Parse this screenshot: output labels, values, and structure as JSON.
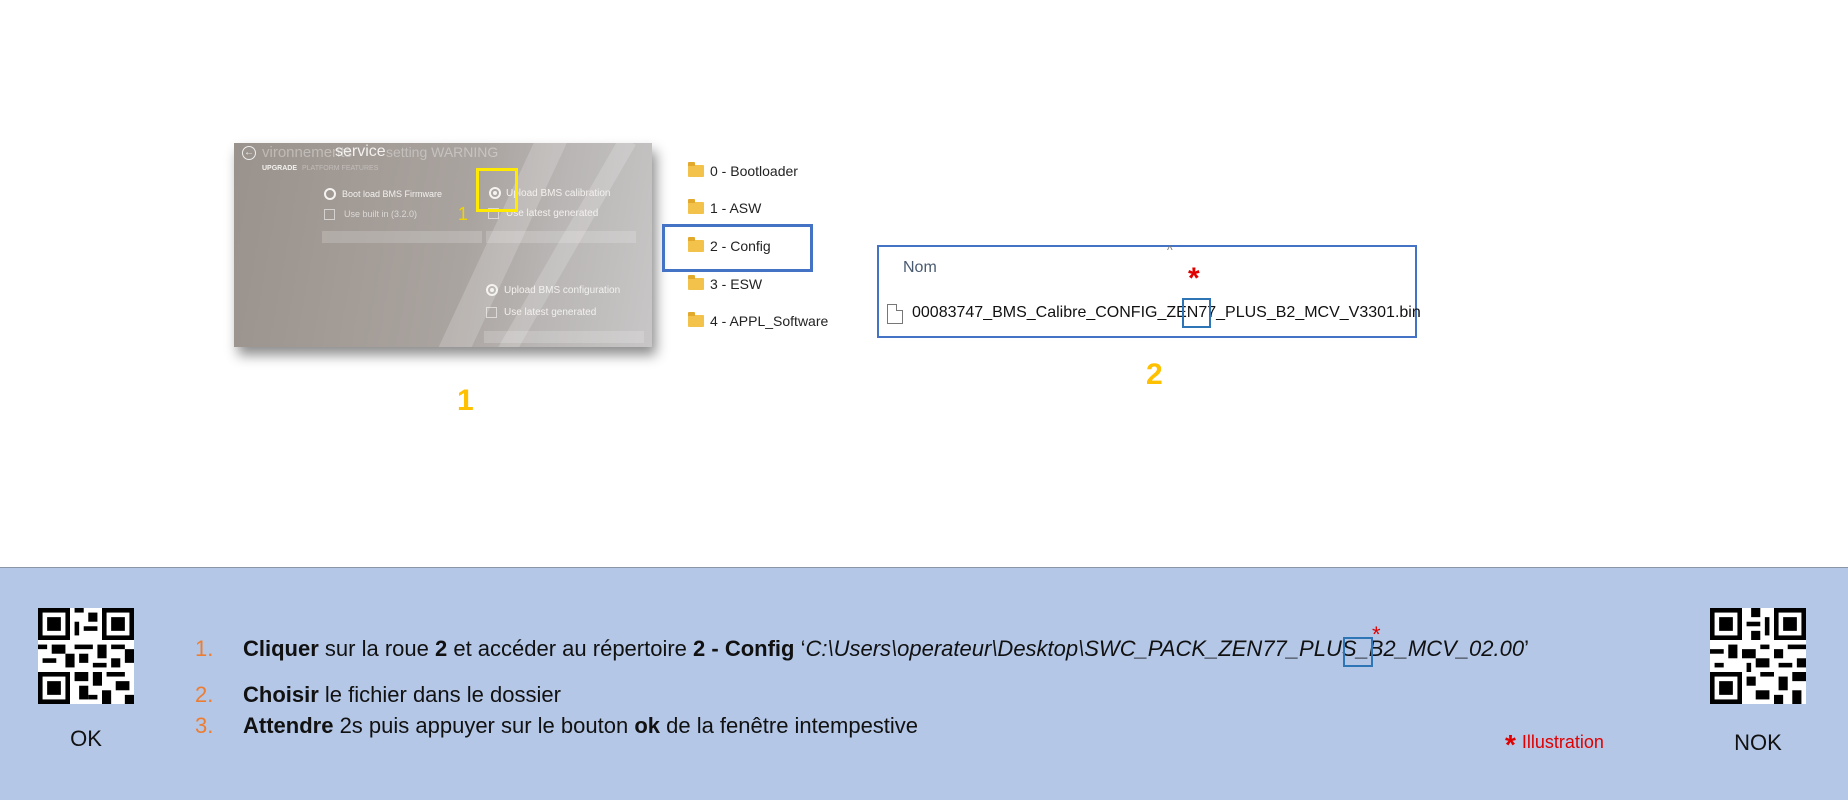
{
  "photo": {
    "header_dim_left": "vironnements",
    "header_title": "service",
    "header_dim_right": "setting  WARNING",
    "tab_upgrade": "UPGRADE",
    "tab_platform": "PLATFORM FEATURES",
    "option_bootload": "Boot load BMS Firmware",
    "option_builtin": "Use built in (3.2.0)",
    "option_calibration": "Upload BMS calibration",
    "option_latest1": "Use latest generated",
    "option_configuration": "Upload BMS configuration",
    "option_latest2": "Use latest generated",
    "marker_number": "1"
  },
  "folders": [
    {
      "label": "0 - Bootloader"
    },
    {
      "label": "1 - ASW"
    },
    {
      "label": "2 - Config"
    },
    {
      "label": "3 - ESW"
    },
    {
      "label": "4 - APPL_Software"
    }
  ],
  "explorer": {
    "column_header": "Nom",
    "sort_caret": "^",
    "file_name": "00083747_BMS_Calibre_CONFIG_ZEN77_PLUS_B2_MCV_V3301.bin",
    "star": "*"
  },
  "labels": {
    "one": "1",
    "two": "2"
  },
  "band": {
    "qr_ok_label": "OK",
    "qr_nok_label": "NOK",
    "steps": [
      {
        "num": "1.",
        "bold1": "Cliquer",
        "text1": " sur la roue ",
        "bold2": "2",
        "text2": " et accéder au répertoire ",
        "bold3": "2 - Config",
        "text3": " ‘",
        "path": "C:\\Users\\operateur\\Desktop\\SWC_PACK_ZEN77_PLUS_B2_MCV_02.00",
        "text4": "’"
      },
      {
        "num": "2.",
        "bold1": "Choisir",
        "text1": " le fichier dans le dossier"
      },
      {
        "num": "3.",
        "bold1": "Attendre",
        "text1": " 2s puis appuyer sur le bouton ",
        "bold2": "ok",
        "text2": " de la fenêtre intempestive"
      }
    ],
    "star": "*",
    "illustration_note": "Illustration"
  },
  "colors": {
    "accent_blue": "#4472c4",
    "band_bg": "#b4c7e7",
    "number_orange": "#ed7d31",
    "label_gold": "#ffc000",
    "star_red": "#e00000"
  }
}
